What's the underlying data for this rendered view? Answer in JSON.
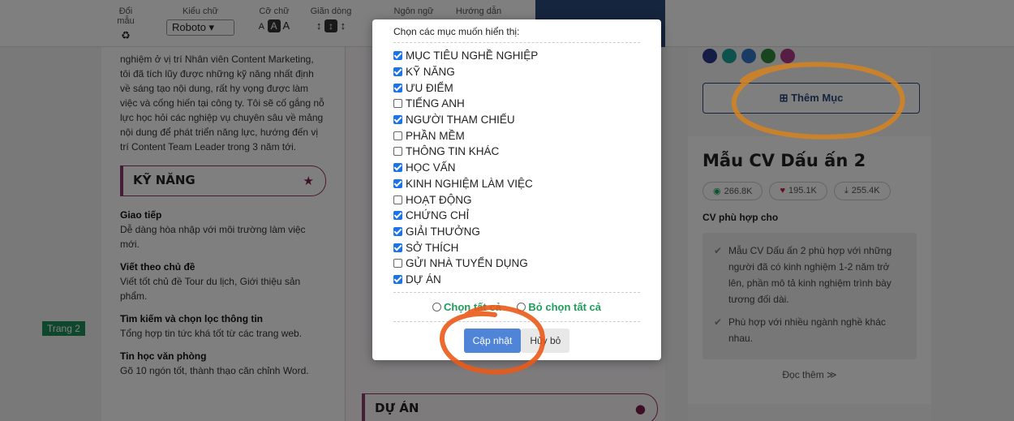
{
  "toolbar": {
    "tools": [
      {
        "label": "Đổi mẫu",
        "icon": "recycle-icon"
      },
      {
        "label": "Kiểu chữ",
        "value": "Roboto"
      },
      {
        "label": "Cỡ chữ",
        "value": "A A A"
      },
      {
        "label": "Giãn dòng",
        "value": "↕"
      },
      {
        "label": "Ngôn ngữ"
      },
      {
        "label": "Hướng dẫn"
      }
    ]
  },
  "cv_left": {
    "intro": "nghiệm ở vị trí Nhân viên Content Marketing, tôi đã tích lũy được những kỹ năng nhất định về sáng tạo nội dung, rất hy vọng được làm việc và cống hiến tại công ty. Tôi sẽ cố gắng nỗ lực học hỏi các nghiệp vụ chuyên sâu về mảng nội dung để phát triển năng lực, hướng đến vị trí Content Team Leader trong 3 năm tới.",
    "skills_heading": "KỸ NĂNG",
    "skills": [
      {
        "name": "Giao tiếp",
        "desc": "Dễ dàng hòa nhập với môi trường làm việc mới."
      },
      {
        "name": "Viết theo chủ đề",
        "desc": "Viết tốt chủ đề Tour du lịch, Giới thiệu sản phẩm."
      },
      {
        "name": "Tìm kiếm và chọn lọc thông tin",
        "desc": "Tổng hợp tin tức khá tốt từ các trang web."
      },
      {
        "name": "Tin học văn phòng",
        "desc": "Gõ 10 ngón tốt, thành thạo căn chỉnh Word."
      }
    ]
  },
  "cv_mid": {
    "du_an_heading": "DỰ ÁN"
  },
  "page_tag": "Trang 2",
  "right_panel": {
    "add_button": "Thêm Mục",
    "template_title": "Mẫu CV Dấu ấn 2",
    "stats": {
      "views": "266.8K",
      "likes": "195.1K",
      "downloads": "255.4K"
    },
    "fit_label": "CV phù hợp cho",
    "fit_items": [
      "Mẫu CV Dấu ấn 2 phù hợp với những người đã có kinh nghiệm 1-2 năm trở lên, phần mô tả kinh nghiệm trình bày tương đối dài.",
      "Phù hợp với nhiều ngành nghề khác nhau."
    ],
    "read_more": "Đọc thêm ≫",
    "swatch_colors": [
      "#2a3a8c",
      "#1aa59a",
      "#3577c9",
      "#2e8b3d",
      "#b03a8a"
    ]
  },
  "modal": {
    "title": "Chọn các mục muốn hiển thị:",
    "options": [
      {
        "label": "MỤC TIÊU NGHỀ NGHIỆP",
        "checked": true
      },
      {
        "label": "KỸ NĂNG",
        "checked": true
      },
      {
        "label": "ƯU ĐIỂM",
        "checked": true
      },
      {
        "label": "TIẾNG ANH",
        "checked": false
      },
      {
        "label": "NGƯỜI THAM CHIẾU",
        "checked": true
      },
      {
        "label": "PHẦN MỀM",
        "checked": false
      },
      {
        "label": "THÔNG TIN KHÁC",
        "checked": false
      },
      {
        "label": "HỌC VẤN",
        "checked": true
      },
      {
        "label": "KINH NGHIỆM LÀM VIỆC",
        "checked": true
      },
      {
        "label": "HOẠT ĐỘNG",
        "checked": false
      },
      {
        "label": "CHỨNG CHỈ",
        "checked": true
      },
      {
        "label": "GIẢI THƯỞNG",
        "checked": true
      },
      {
        "label": "SỞ THÍCH",
        "checked": true
      },
      {
        "label": "GỬI NHÀ TUYỂN DỤNG",
        "checked": false
      },
      {
        "label": "DỰ ÁN",
        "checked": true
      }
    ],
    "select_all": "Chọn tất cả",
    "deselect_all": "Bỏ chọn tất cả",
    "update_button": "Cập nhật",
    "cancel_button": "Hủy bỏ"
  }
}
